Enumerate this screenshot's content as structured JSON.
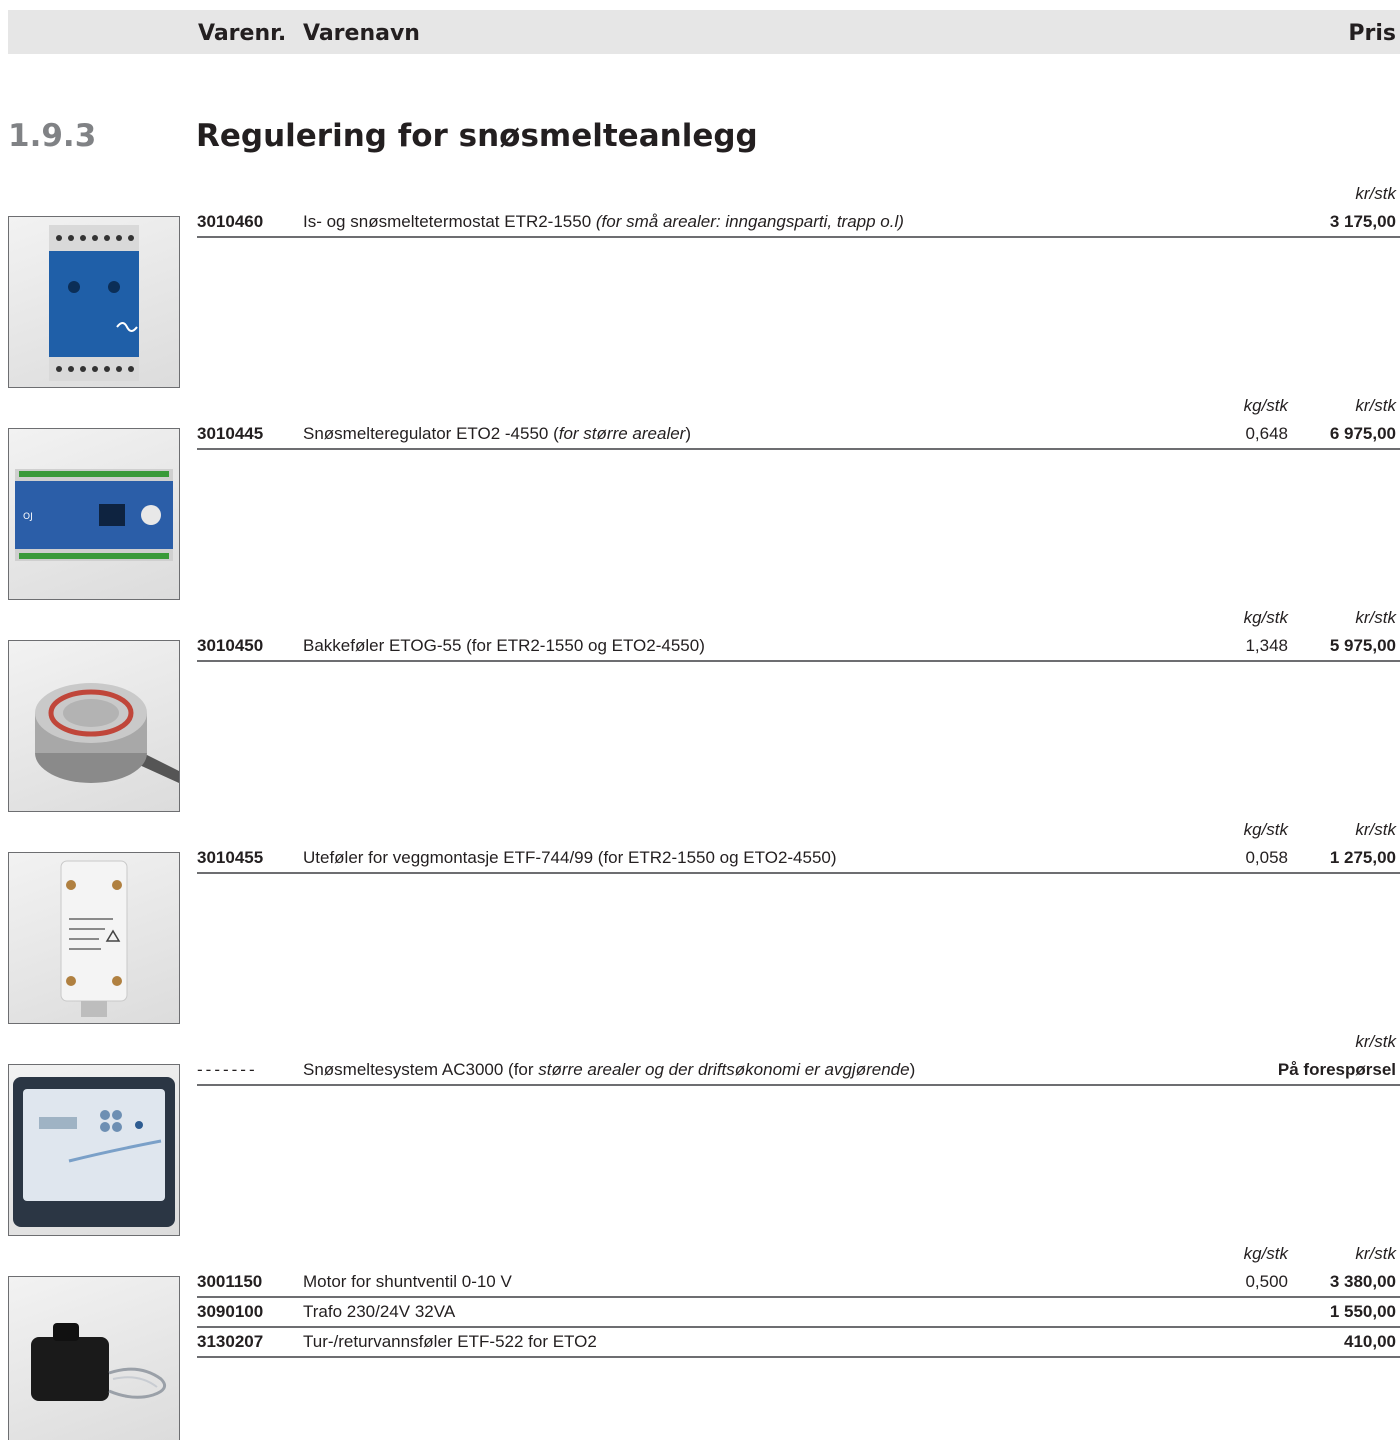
{
  "header": {
    "varenr": "Varenr.",
    "varenavn": "Varenavn",
    "pris": "Pris"
  },
  "section": {
    "number": "1.9.3",
    "title": "Regulering for snøsmelteanlegg"
  },
  "units": {
    "kg": "kg/stk",
    "kr": "kr/stk"
  },
  "products": [
    {
      "code": "3010460",
      "name_plain": "Is- og snøsmeltetermostat ETR2-1550 ",
      "name_italic": "(for små arealer: inngangsparti, trapp o.l)",
      "name_tail": "",
      "price": "3 175,00",
      "image": "thermostat-etr2-photo"
    },
    {
      "code": "3010445",
      "name_plain": "Snøsmelteregulator ETO2 -4550 (",
      "name_italic": "for større arealer",
      "name_tail": ")",
      "kg": "0,648",
      "price": "6 975,00",
      "image": "controller-eto2-photo"
    },
    {
      "code": "3010450",
      "name_plain": "Bakkeføler ETOG-55 (for ETR2-1550 og ETO2-4550)",
      "name_italic": "",
      "name_tail": "",
      "kg": "1,348",
      "price": "5 975,00",
      "image": "ground-sensor-photo"
    },
    {
      "code": "3010455",
      "name_plain": "Uteføler for veggmontasje ETF-744/99 (for ETR2-1550 og ETO2-4550)",
      "name_italic": "",
      "name_tail": "",
      "kg": "0,058",
      "price": "1 275,00",
      "image": "outdoor-sensor-photo"
    },
    {
      "code": "-------",
      "name_plain": "Snøsmeltesystem AC3000 (for ",
      "name_italic": "større arealer og der driftsøkonomi er avgjørende",
      "name_tail": ")",
      "price": "På forespørsel",
      "image": "ac3000-system-photo"
    },
    {
      "code": "3001150",
      "name_plain": "Motor for shuntventil 0-10 V",
      "kg": "0,500",
      "price": "3 380,00",
      "image": "shunt-motor-photo"
    },
    {
      "code": "3090100",
      "name_plain": "Trafo 230/24V 32VA",
      "price": "1 550,00"
    },
    {
      "code": "3130207",
      "name_plain": "Tur-/returvannsføler ETF-522 for ETO2",
      "price": "410,00"
    }
  ]
}
